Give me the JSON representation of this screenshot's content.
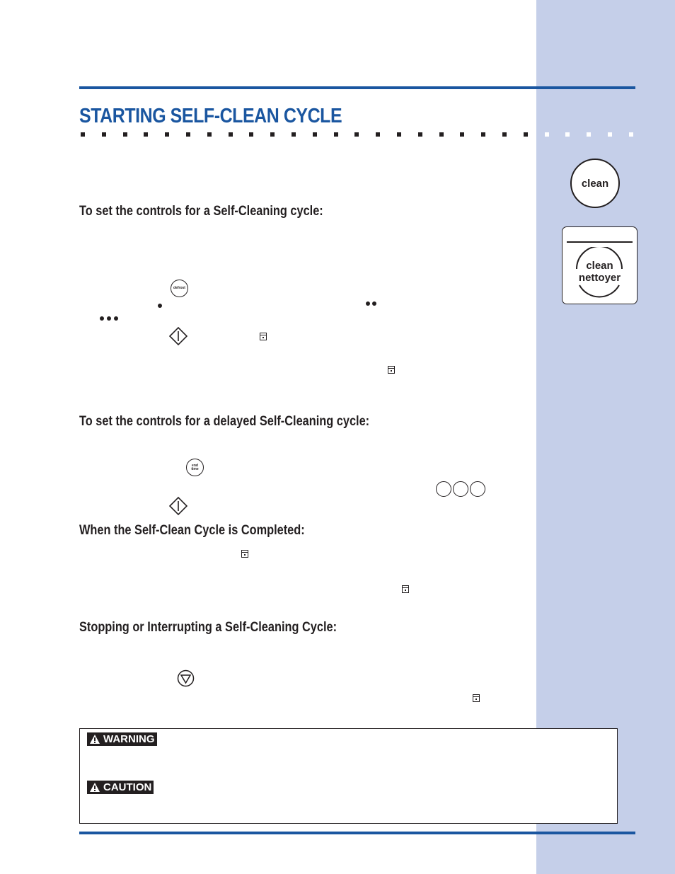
{
  "colors": {
    "accent": "#1a56a0",
    "sidebar": "#c5cfe9",
    "text": "#231f20"
  },
  "title": "STARTING SELF-CLEAN CYCLE",
  "sections": [
    {
      "heading": "To set the controls for a Self-Cleaning cycle:"
    },
    {
      "heading": "To set the controls for a delayed Self-Cleaning cycle:"
    },
    {
      "heading": "When the Self-Clean Cycle is Completed:"
    },
    {
      "heading": "Stopping or Interrupting a Self-Cleaning Cycle:"
    }
  ],
  "icons": {
    "defrost": "defrost",
    "end_time_1": "end",
    "end_time_2": "time"
  },
  "sidebar": {
    "clean_button": "clean",
    "clean_nettoyer_1": "clean",
    "clean_nettoyer_2": "nettoyer"
  },
  "alerts": {
    "warning": "WARNING",
    "caution": "CAUTION"
  }
}
